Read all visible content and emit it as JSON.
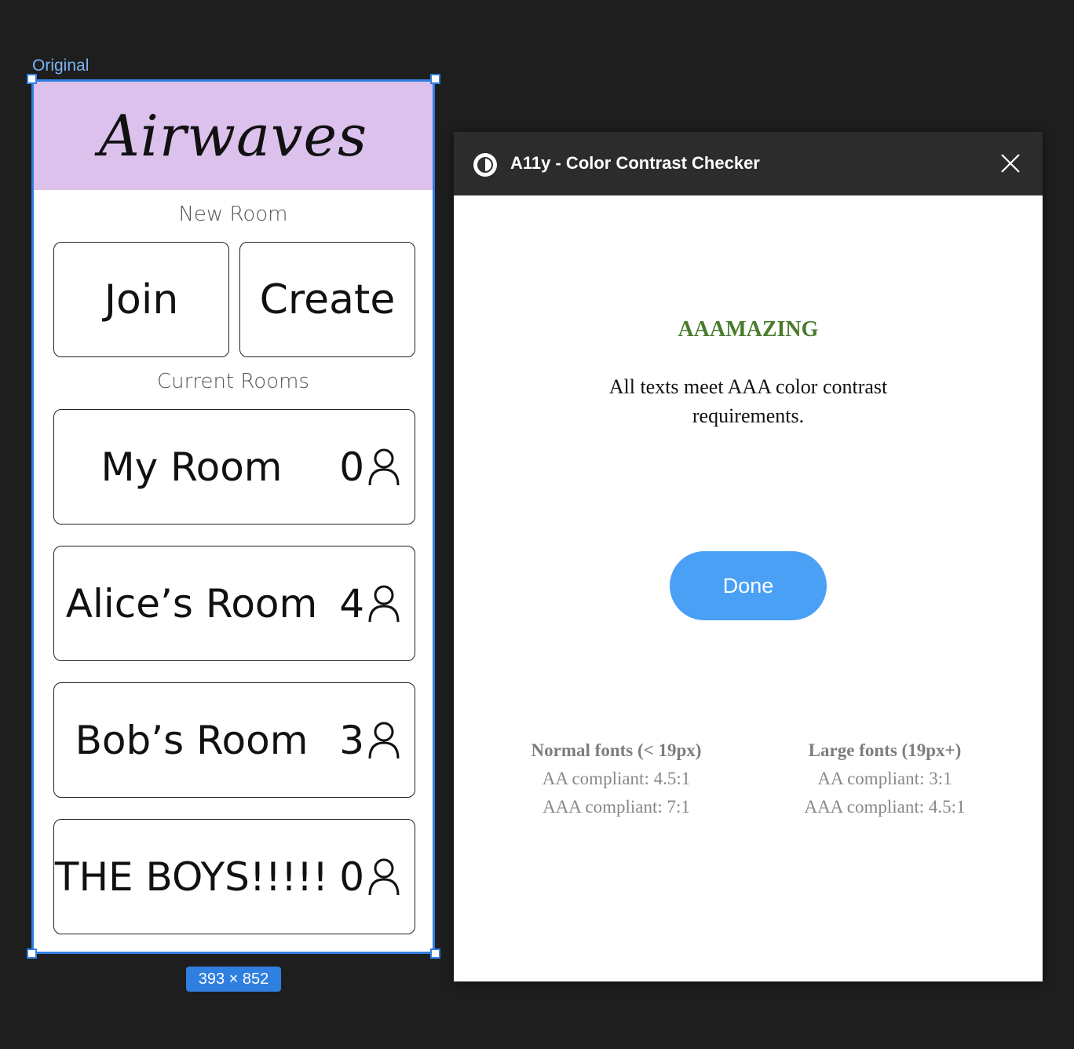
{
  "frame": {
    "label": "Original",
    "size": "393 × 852"
  },
  "app": {
    "title": "Airwaves",
    "header_color": "#dcc1ed",
    "new_room_label": "New Room",
    "join_label": "Join",
    "create_label": "Create",
    "current_rooms_label": "Current Rooms",
    "rooms": [
      {
        "name": "My Room",
        "count": "0"
      },
      {
        "name": "Alice’s Room",
        "count": "4"
      },
      {
        "name": "Bob’s Room",
        "count": "3"
      },
      {
        "name": "THE BOYS!!!!!",
        "count": "0"
      }
    ]
  },
  "plugin": {
    "title": "A11y - Color Contrast Checker",
    "status_title": "AAAMAZING",
    "status_color": "#4a7b2c",
    "status_message": "All texts meet AAA color contrast requirements.",
    "done_label": "Done",
    "accent": "#4aa0f5",
    "normal_fonts": {
      "heading": "Normal fonts (< 19px)",
      "aa": "AA compliant: 4.5:1",
      "aaa": "AAA compliant: 7:1"
    },
    "large_fonts": {
      "heading": "Large fonts (19px+)",
      "aa": "AA compliant: 3:1",
      "aaa": "AAA compliant: 4.5:1"
    }
  }
}
